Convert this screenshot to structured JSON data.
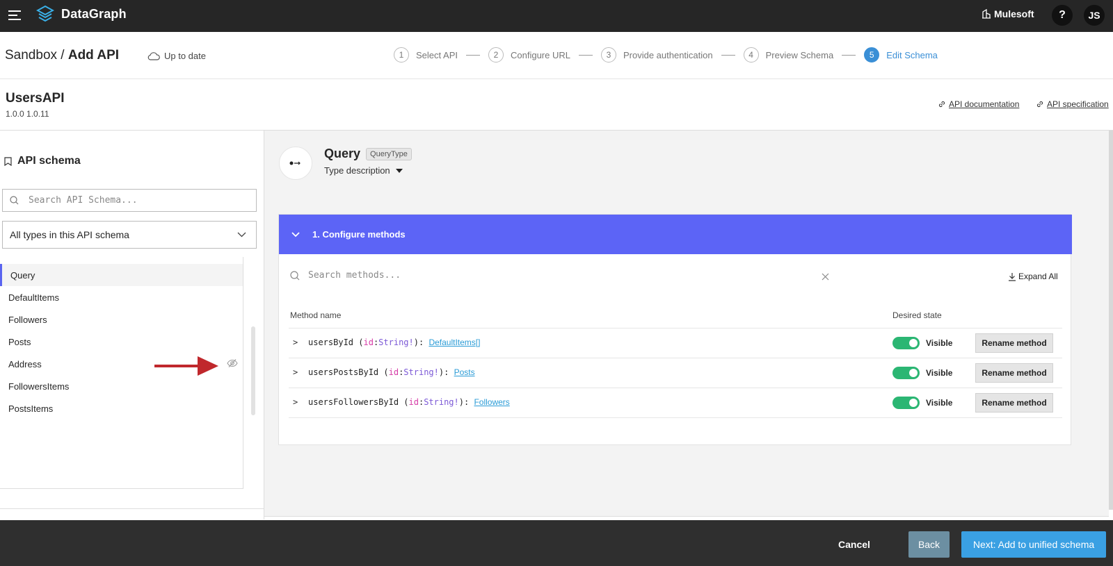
{
  "app": {
    "brand": "DataGraph",
    "org": "Mulesoft",
    "help": "?",
    "user_initials": "JS"
  },
  "breadcrumb": {
    "parent": "Sandbox",
    "separator": "/",
    "current": "Add API"
  },
  "sync_status": "Up to date",
  "steps": [
    {
      "num": "1",
      "label": "Select API"
    },
    {
      "num": "2",
      "label": "Configure URL"
    },
    {
      "num": "3",
      "label": "Provide authentication"
    },
    {
      "num": "4",
      "label": "Preview Schema"
    },
    {
      "num": "5",
      "label": "Edit Schema",
      "active": true
    }
  ],
  "api": {
    "name": "UsersAPI",
    "version": "1.0.0 1.0.11",
    "doc_link": "API documentation",
    "spec_link": "API specification"
  },
  "schema_panel": {
    "title": "API schema",
    "search_placeholder": "Search API Schema...",
    "filter_value": "All types in this API schema",
    "types": [
      "Query",
      "DefaultItems",
      "Followers",
      "Posts",
      "Address",
      "FollowersItems",
      "PostsItems"
    ],
    "active_type": "Query",
    "hidden_type": "Address"
  },
  "type_detail": {
    "name": "Query",
    "badge": "QueryType",
    "description_toggle": "Type description"
  },
  "methods_section": {
    "title": "1. Configure methods",
    "search_placeholder": "Search methods...",
    "expand_label": "Expand All",
    "col_method": "Method name",
    "col_state": "Desired state",
    "rows": [
      {
        "name": "usersById",
        "param": "id",
        "param_type": "String!",
        "return_type": "DefaultItems[]",
        "state": "Visible",
        "rename": "Rename method"
      },
      {
        "name": "usersPostsById",
        "param": "id",
        "param_type": "String!",
        "return_type": "Posts",
        "state": "Visible",
        "rename": "Rename method"
      },
      {
        "name": "usersFollowersById",
        "param": "id",
        "param_type": "String!",
        "return_type": "Followers",
        "state": "Visible",
        "rename": "Rename method"
      }
    ]
  },
  "footer": {
    "cancel": "Cancel",
    "back": "Back",
    "next": "Next: Add to unified schema"
  },
  "colors": {
    "accent": "#5c64f6",
    "step_active": "#3a8fd6",
    "toggle_on": "#2bb673",
    "arrow": "#c0282c"
  }
}
